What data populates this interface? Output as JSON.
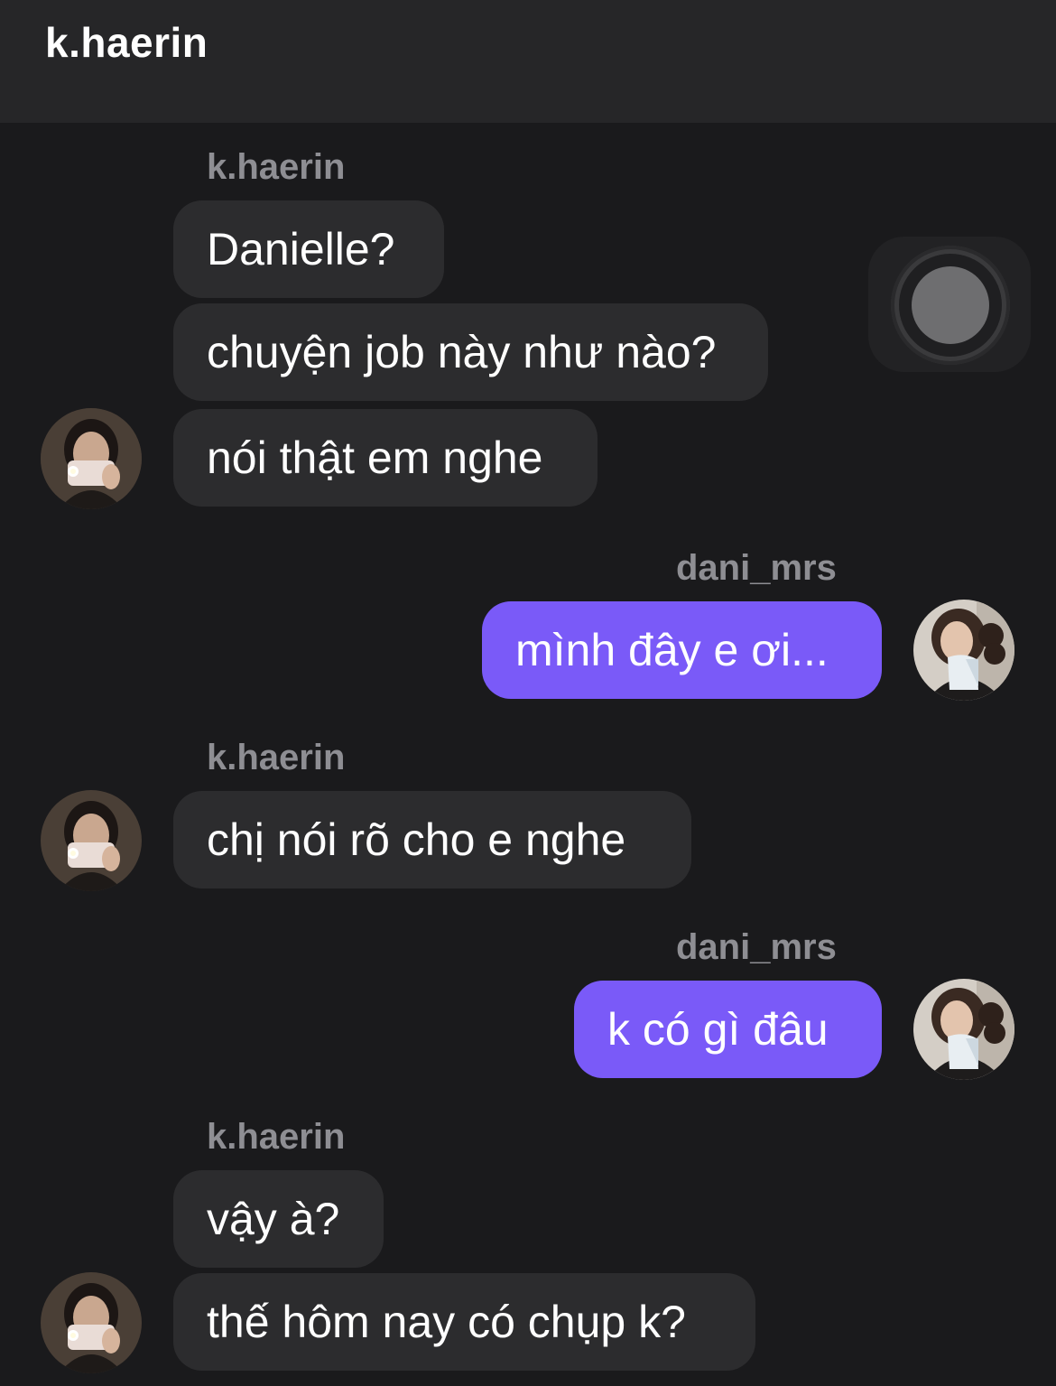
{
  "header": {
    "title": "k.haerin"
  },
  "colors": {
    "background": "#1a1a1c",
    "header": "#262628",
    "incoming_bubble": "#2c2c2e",
    "outgoing_bubble": "#7a5af8",
    "sender_name": "#8e8e93"
  },
  "groups": [
    {
      "sender": "k.haerin",
      "direction": "incoming",
      "messages": [
        "Danielle?",
        "chuyện job này như nào?",
        "nói thật em nghe"
      ]
    },
    {
      "sender": "dani_mrs",
      "direction": "outgoing",
      "messages": [
        "mình đây e ơi..."
      ]
    },
    {
      "sender": "k.haerin",
      "direction": "incoming",
      "messages": [
        "chị nói rõ cho e nghe"
      ]
    },
    {
      "sender": "dani_mrs",
      "direction": "outgoing",
      "messages": [
        "k có gì đâu"
      ]
    },
    {
      "sender": "k.haerin",
      "direction": "incoming",
      "messages": [
        "vậy à?",
        "thế hôm nay có chụp k?"
      ]
    }
  ],
  "overlay": {
    "icon": "assistive-touch-icon"
  }
}
